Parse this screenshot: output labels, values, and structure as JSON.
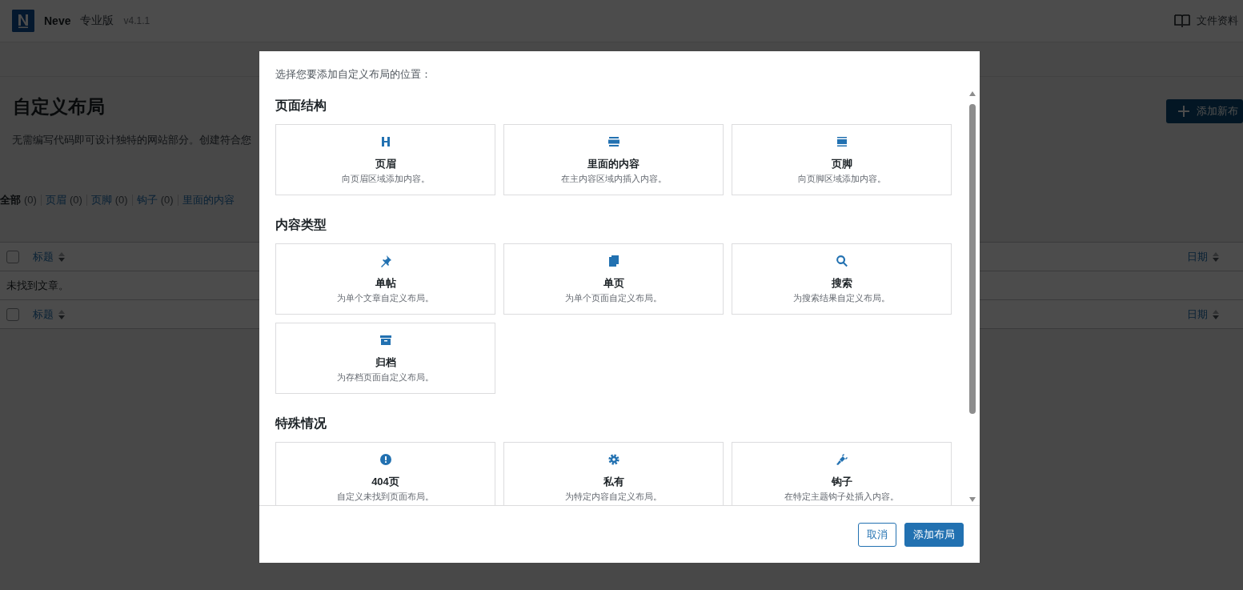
{
  "header": {
    "brand": "Neve",
    "edition": "专业版",
    "version": "v4.1.1",
    "docs_link": "文件资料"
  },
  "page": {
    "title": "自定义布局",
    "description": "无需编写代码即可设计独特的网站部分。创建符合您",
    "add_button": "添加新布"
  },
  "filters": [
    {
      "label": "全部",
      "count": "(0)",
      "selected": true
    },
    {
      "label": "页眉",
      "count": "(0)",
      "selected": false
    },
    {
      "label": "页脚",
      "count": "(0)",
      "selected": false
    },
    {
      "label": "钩子",
      "count": "(0)",
      "selected": false
    },
    {
      "label": "里面的内容",
      "selected": false
    }
  ],
  "table": {
    "select_all_checked": false,
    "footer_select_all_checked": false,
    "columns": [
      "标题",
      "日期"
    ],
    "empty_message": "未找到文章。",
    "footer_columns": [
      "标题",
      "日期"
    ]
  },
  "modal": {
    "prompt": "选择您要添加自定义布局的位置：",
    "sections": [
      {
        "title": "页面结构",
        "cards": [
          {
            "kind": "header",
            "title": "页眉",
            "description": "向页眉区域添加内容。"
          },
          {
            "kind": "content",
            "title": "里面的内容",
            "description": "在主内容区域内插入内容。"
          },
          {
            "kind": "footer",
            "title": "页脚",
            "description": "向页脚区域添加内容。"
          }
        ]
      },
      {
        "title": "内容类型",
        "cards": [
          {
            "kind": "pin",
            "title": "单帖",
            "description": "为单个文章自定义布局。"
          },
          {
            "kind": "pages",
            "title": "单页",
            "description": "为单个页面自定义布局。"
          },
          {
            "kind": "search",
            "title": "搜索",
            "description": "为搜索结果自定义布局。"
          },
          {
            "kind": "archive",
            "title": "归档",
            "description": "为存档页面自定义布局。"
          }
        ]
      },
      {
        "title": "特殊情况",
        "cards": [
          {
            "kind": "alert",
            "title": "404页",
            "description": "自定义未找到页面布局。"
          },
          {
            "kind": "gear",
            "title": "私有",
            "description": "为特定内容自定义布局。"
          },
          {
            "kind": "hook",
            "title": "钩子",
            "description": "在特定主题钩子处插入内容。"
          }
        ]
      }
    ],
    "buttons": [
      {
        "label": "取消",
        "kind": "secondary"
      },
      {
        "label": "添加布局",
        "kind": "primary"
      }
    ]
  }
}
